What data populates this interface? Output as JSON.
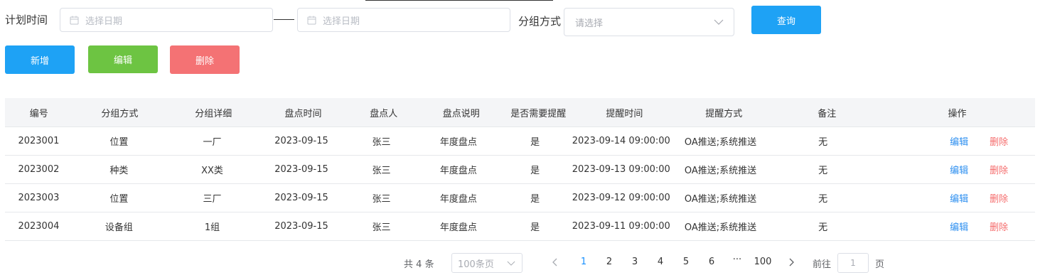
{
  "filters": {
    "plan_time_label": "计划时间",
    "start_date_placeholder": "选择日期",
    "end_date_placeholder": "选择日期",
    "group_method_label": "分组方式",
    "group_method_placeholder": "请选择",
    "query_button": "查询"
  },
  "actions": {
    "add_button": "新增",
    "edit_button": "编辑",
    "delete_button": "删除"
  },
  "table": {
    "headers": [
      "编号",
      "分组方式",
      "分组详细",
      "盘点时间",
      "盘点人",
      "盘点说明",
      "是否需要提醒",
      "提醒时间",
      "提醒方式",
      "备注",
      "操作"
    ],
    "rows": [
      {
        "id": "2023001",
        "group_method": "位置",
        "group_detail": "一厂",
        "check_time": "2023-09-15",
        "checker": "张三",
        "desc": "年度盘点",
        "remind": "是",
        "remind_time": "2023-09-14 09:00:00",
        "remind_way": "OA推送;系统推送",
        "note": "无",
        "edit": "编辑",
        "delete": "删除"
      },
      {
        "id": "2023002",
        "group_method": "种类",
        "group_detail": "XX类",
        "check_time": "2023-09-15",
        "checker": "张三",
        "desc": "年度盘点",
        "remind": "是",
        "remind_time": "2023-09-13 09:00:00",
        "remind_way": "OA推送;系统推送",
        "note": "无",
        "edit": "编辑",
        "delete": "删除"
      },
      {
        "id": "2023003",
        "group_method": "位置",
        "group_detail": "三厂",
        "check_time": "2023-09-15",
        "checker": "张三",
        "desc": "年度盘点",
        "remind": "是",
        "remind_time": "2023-09-12 09:00:00",
        "remind_way": "OA推送;系统推送",
        "note": "无",
        "edit": "编辑",
        "delete": "删除"
      },
      {
        "id": "2023004",
        "group_method": "设备组",
        "group_detail": "1组",
        "check_time": "2023-09-15",
        "checker": "张三",
        "desc": "年度盘点",
        "remind": "是",
        "remind_time": "2023-09-11 09:00:00",
        "remind_way": "OA推送;系统推送",
        "note": "无",
        "edit": "编辑",
        "delete": "删除"
      }
    ]
  },
  "pagination": {
    "total_prefix": "共",
    "total_count": "4",
    "total_suffix": "条",
    "page_size": "100条页",
    "pages": [
      "1",
      "2",
      "3",
      "4",
      "5",
      "6"
    ],
    "ellipsis": "···",
    "last_page": "100",
    "current_page": "1",
    "goto_prefix": "前往",
    "goto_value": "1",
    "goto_suffix": "页"
  },
  "colors": {
    "primary": "#1ea2f5",
    "success": "#6dc442",
    "danger": "#f47274",
    "link_blue": "#2d8ff0",
    "link_red": "#f56c6c"
  }
}
